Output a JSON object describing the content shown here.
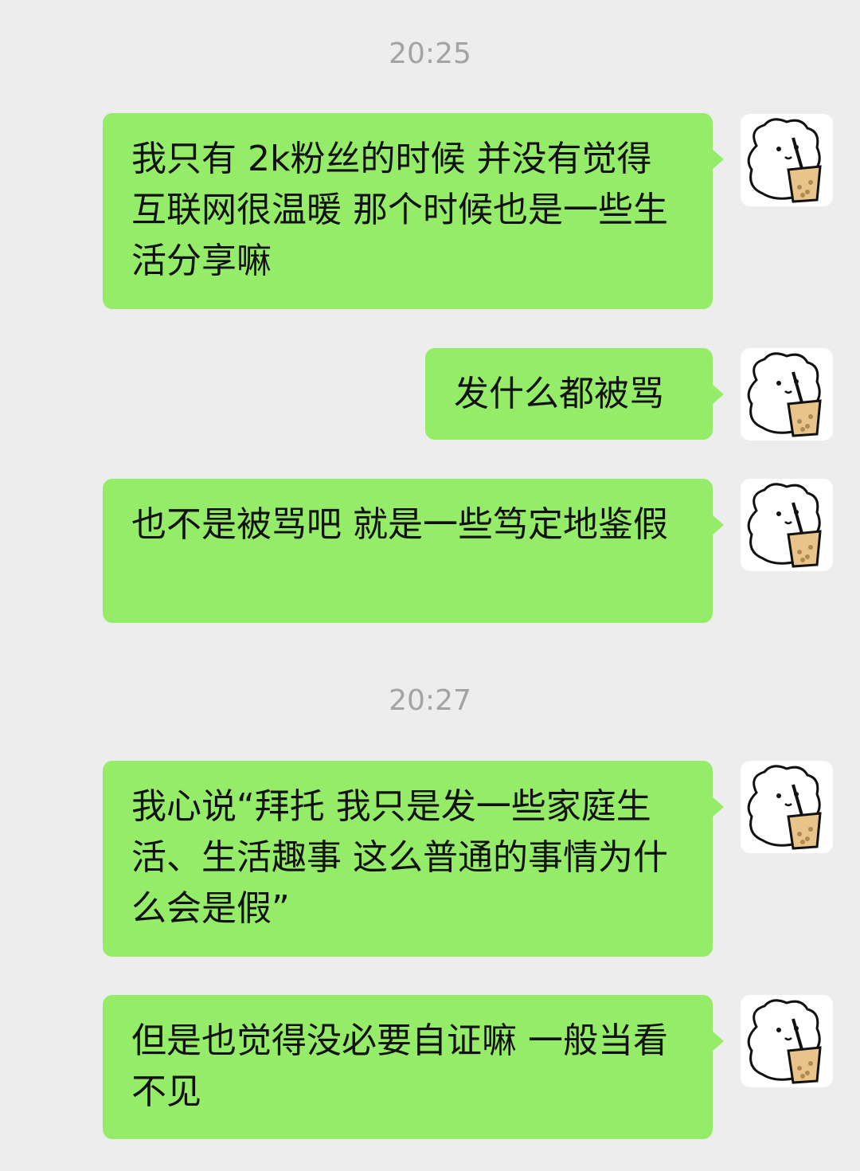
{
  "timestamps": [
    "20:25",
    "20:27"
  ],
  "messages": [
    {
      "text": "我只有 2k粉丝的时候 并没有觉得互联网很温暖 那个时候也是一些生活分享嘛"
    },
    {
      "text": "发什么都被骂"
    },
    {
      "text": "也不是被骂吧 就是一些笃定地鉴假"
    },
    {
      "text": "我心说“拜托 我只是发一些家庭生活、生活趣事 这么普通的事情为什么会是假”"
    },
    {
      "text": "但是也觉得没必要自证嘛 一般当看不见"
    }
  ],
  "avatar": {
    "icon": "dog-with-bubble-tea-icon",
    "bubble_color": "#95ec69",
    "tea_color": "#e8c48a"
  }
}
